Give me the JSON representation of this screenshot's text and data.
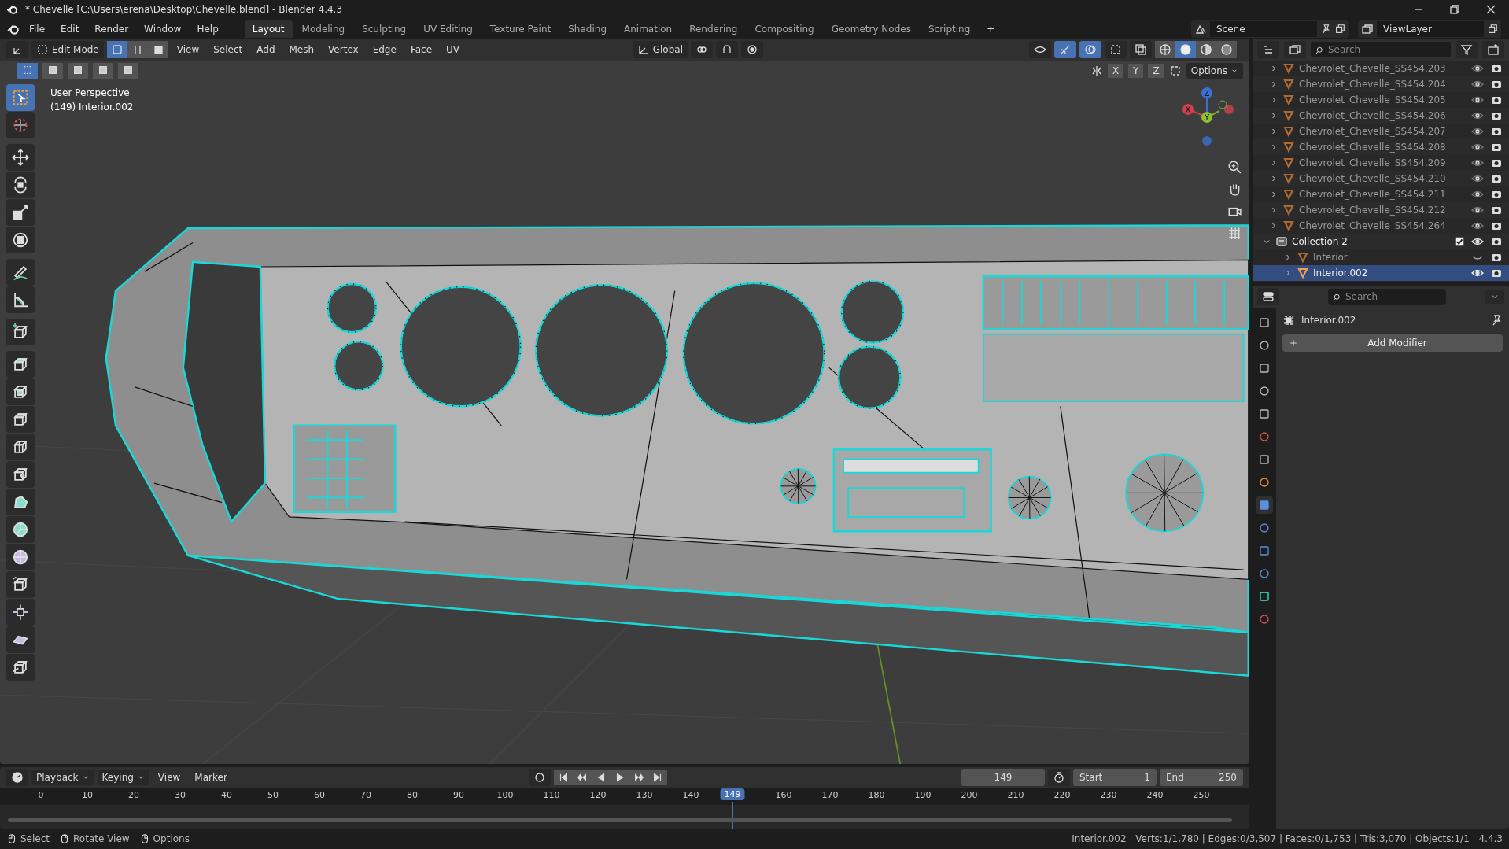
{
  "title_bar": {
    "title": "* Chevelle [C:\\Users\\erena\\Desktop\\Chevelle.blend] - Blender 4.4.3"
  },
  "menu": [
    "File",
    "Edit",
    "Render",
    "Window",
    "Help"
  ],
  "workspace_tabs": [
    {
      "label": "Layout",
      "selected": true
    },
    {
      "label": "Modeling",
      "selected": false
    },
    {
      "label": "Sculpting",
      "selected": false
    },
    {
      "label": "UV Editing",
      "selected": false
    },
    {
      "label": "Texture Paint",
      "selected": false
    },
    {
      "label": "Shading",
      "selected": false
    },
    {
      "label": "Animation",
      "selected": false
    },
    {
      "label": "Rendering",
      "selected": false
    },
    {
      "label": "Compositing",
      "selected": false
    },
    {
      "label": "Geometry Nodes",
      "selected": false
    },
    {
      "label": "Scripting",
      "selected": false
    }
  ],
  "add_workspace": "+",
  "scene": "Scene",
  "view_layer": "ViewLayer",
  "viewport_header": {
    "mode": "Edit Mode",
    "select_modes": [
      {
        "selected": true
      },
      {
        "selected": false
      },
      {
        "selected": false
      }
    ],
    "menus": [
      "View",
      "Select",
      "Add",
      "Mesh",
      "Vertex",
      "Edge",
      "Face",
      "UV"
    ],
    "orientation": "Global",
    "axes": [
      "X",
      "Y",
      "Z"
    ],
    "options": "Options"
  },
  "viewport": {
    "view_name": "User Perspective",
    "object_info": "(149) Interior.002",
    "gizmo": [
      "Z",
      "Y",
      "X"
    ]
  },
  "toolbar": [
    {
      "selected": true
    },
    {
      "selected": false
    },
    {
      "selected": false
    },
    {
      "selected": false
    },
    {
      "selected": false
    },
    {
      "selected": false
    },
    {
      "selected": false
    },
    {
      "selected": false
    },
    {
      "selected": false
    },
    {
      "selected": false
    },
    {
      "selected": false
    },
    {
      "selected": false
    },
    {
      "selected": false
    },
    {
      "selected": false
    },
    {
      "selected": false
    },
    {
      "selected": false
    },
    {
      "selected": false
    },
    {
      "selected": false
    },
    {
      "selected": false
    },
    {
      "selected": false
    },
    {
      "selected": false
    }
  ],
  "outliner": {
    "search_placeholder": "Search",
    "rows": [
      {
        "kind": "object",
        "name": "Chevrolet_Chevelle_SS454.203",
        "selected": false,
        "visible": true
      },
      {
        "kind": "object",
        "name": "Chevrolet_Chevelle_SS454.204",
        "selected": false,
        "visible": true
      },
      {
        "kind": "object",
        "name": "Chevrolet_Chevelle_SS454.205",
        "selected": false,
        "visible": true
      },
      {
        "kind": "object",
        "name": "Chevrolet_Chevelle_SS454.206",
        "selected": false,
        "visible": true
      },
      {
        "kind": "object",
        "name": "Chevrolet_Chevelle_SS454.207",
        "selected": false,
        "visible": true
      },
      {
        "kind": "object",
        "name": "Chevrolet_Chevelle_SS454.208",
        "selected": false,
        "visible": true
      },
      {
        "kind": "object",
        "name": "Chevrolet_Chevelle_SS454.209",
        "selected": false,
        "visible": true
      },
      {
        "kind": "object",
        "name": "Chevrolet_Chevelle_SS454.210",
        "selected": false,
        "visible": true
      },
      {
        "kind": "object",
        "name": "Chevrolet_Chevelle_SS454.211",
        "selected": false,
        "visible": true
      },
      {
        "kind": "object",
        "name": "Chevrolet_Chevelle_SS454.212",
        "selected": false,
        "visible": true
      },
      {
        "kind": "object",
        "name": "Chevrolet_Chevelle_SS454.264",
        "selected": false,
        "visible": true
      },
      {
        "kind": "collection",
        "name": "Collection 2",
        "expanded": true,
        "checked": true,
        "visible": true,
        "children": [
          {
            "kind": "object",
            "name": "Interior",
            "selected": false,
            "visible": false
          },
          {
            "kind": "object",
            "name": "Interior.002",
            "selected": true,
            "visible": true
          }
        ]
      }
    ]
  },
  "properties": {
    "search_placeholder": "Search",
    "object_name": "Interior.002",
    "add_modifier": "Add Modifier",
    "tabs": [
      {
        "selected": false
      },
      {
        "selected": false
      },
      {
        "selected": false
      },
      {
        "selected": false
      },
      {
        "selected": false
      },
      {
        "selected": false
      },
      {
        "selected": false
      },
      {
        "selected": false
      },
      {
        "selected": true
      },
      {
        "selected": false
      },
      {
        "selected": false
      },
      {
        "selected": false
      },
      {
        "selected": false
      },
      {
        "selected": false
      }
    ]
  },
  "timeline": {
    "menus": [
      "Playback",
      "Keying",
      "View",
      "Marker"
    ],
    "current_frame": "149",
    "start_label": "Start",
    "start": "1",
    "end_label": "End",
    "end": "250",
    "ticks": [
      "0",
      "10",
      "20",
      "30",
      "40",
      "50",
      "60",
      "70",
      "80",
      "90",
      "100",
      "110",
      "120",
      "130",
      "140",
      "160",
      "170",
      "180",
      "190",
      "200",
      "210",
      "220",
      "230",
      "240",
      "250"
    ],
    "playhead": "149"
  },
  "status_bar": {
    "hints": [
      "Select",
      "Rotate View",
      "Options"
    ],
    "stats": "Interior.002 | Verts:1/1,780 | Edges:0/3,507 | Faces:0/1,753 | Tris:3,070 | Objects:1/1 | 4.4.3"
  }
}
